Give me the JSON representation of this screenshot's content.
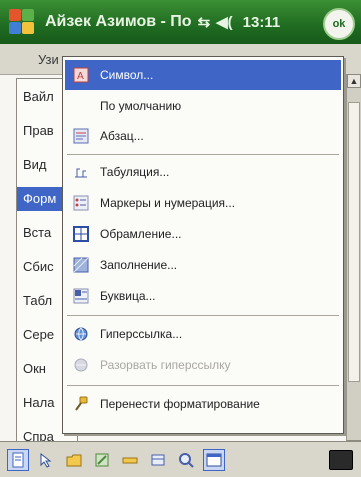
{
  "titlebar": {
    "app_title": "Айзек Азимов - По",
    "signal_glyph": "⇆",
    "volume_glyph": "◀(",
    "time": "13:11",
    "ok_label": "ok"
  },
  "document": {
    "top_label": "Узи"
  },
  "underlying_menu": {
    "items": [
      {
        "label": "Вайл"
      },
      {
        "label": "Прав"
      },
      {
        "label": "Вид"
      },
      {
        "label": "Форм",
        "selected": true
      },
      {
        "label": "Вста"
      },
      {
        "label": "Сбис"
      },
      {
        "label": "Табл"
      },
      {
        "label": "Сере"
      },
      {
        "label": "Окн"
      },
      {
        "label": "Нала"
      },
      {
        "label": "Спра"
      }
    ]
  },
  "popup_menu": {
    "items": [
      {
        "label": "Символ...",
        "icon": "font-icon",
        "selected": true
      },
      {
        "label": "По умолчанию",
        "icon": "none"
      },
      {
        "label": "Абзац...",
        "icon": "paragraph-icon"
      },
      {
        "label": "Табуляция...",
        "icon": "tab-stops-icon"
      },
      {
        "label": "Маркеры и нумерация...",
        "icon": "bullets-icon"
      },
      {
        "label": "Обрамление...",
        "icon": "borders-icon"
      },
      {
        "label": "Заполнение...",
        "icon": "shading-icon"
      },
      {
        "label": "Буквица...",
        "icon": "dropcap-icon"
      },
      {
        "label": "Гиперссылка...",
        "icon": "hyperlink-icon"
      },
      {
        "label": "Разорвать гиперссылку",
        "icon": "unlink-icon",
        "disabled": true
      },
      {
        "label": "Перенести форматирование",
        "icon": "format-painter-icon"
      }
    ]
  },
  "toolbar": {
    "tools": [
      "document-icon",
      "select-icon",
      "open-icon",
      "edit-icon",
      "highlight-icon",
      "insert-icon",
      "zoom-icon",
      "table-icon"
    ]
  },
  "colors": {
    "titlebar": "#1f6b21",
    "selection": "#3f66c6"
  }
}
